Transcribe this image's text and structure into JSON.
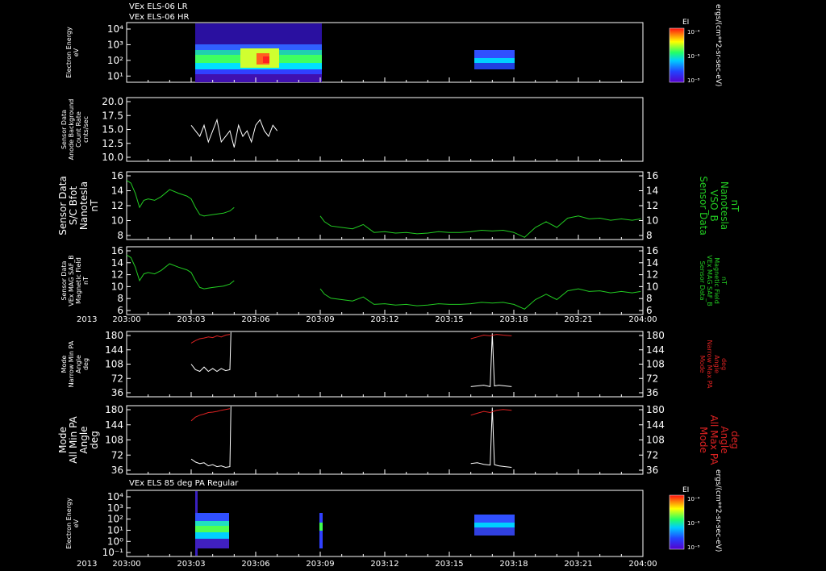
{
  "header": {
    "title_line1": "VEx ELS-06 LR",
    "title_line2": "VEx ELS-06 HR",
    "bottom_title": "VEx ELS 85 deg PA Regular"
  },
  "year_label": "2013",
  "time_ticks": [
    "203:00",
    "203:03",
    "203:06",
    "203:09",
    "203:12",
    "203:15",
    "203:18",
    "203:21",
    "204:00"
  ],
  "colorbar": {
    "title": "EI",
    "labels": [
      "10⁻⁴",
      "10⁻⁶",
      "10⁻⁸"
    ],
    "unit": "ergs/(cm**2-sr-sec-eV)"
  },
  "colors": {
    "background": "#000000",
    "axis": "#ffffff",
    "white_series": "#ffffff",
    "green_series": "#22cc22",
    "red_series": "#dd2222"
  },
  "panels": [
    {
      "id": "p1",
      "ylabel": [
        "Electron Energy",
        "eV"
      ],
      "ticks": [
        "10⁴",
        "10³",
        "10²",
        "10¹"
      ]
    },
    {
      "id": "p2",
      "ylabel": [
        "Sensor Data",
        "Anode Background",
        "Count Rate",
        "cnts/sec"
      ],
      "ticks": [
        "20.0",
        "17.5",
        "15.0",
        "12.5",
        "10.0"
      ]
    },
    {
      "id": "p3",
      "ylabel": [
        "Sensor Data",
        "S/C Bfot",
        "Nanotesla",
        "nT"
      ],
      "ticks": [
        "16",
        "14",
        "12",
        "10",
        "8"
      ],
      "rlabel": [
        "Sensor Data",
        "VSO_B",
        "Nanotesla",
        "nT"
      ],
      "rticks": [
        "16",
        "14",
        "12",
        "10",
        "8"
      ]
    },
    {
      "id": "p4",
      "ylabel": [
        "Sensor Data",
        "VEx MAG SAF_B",
        "Magnetic Field",
        "nT"
      ],
      "ticks": [
        "16",
        "14",
        "12",
        "10",
        "8",
        "6"
      ],
      "rlabel": [
        "Sensor Data",
        "VEx MAG SAF_B",
        "Magnetic Field",
        "nT"
      ],
      "rticks": [
        "16",
        "14",
        "12",
        "10",
        "8",
        "6"
      ]
    },
    {
      "id": "p5",
      "ylabel": [
        "Mode",
        "Narrow Min PA",
        "Angle",
        "deg"
      ],
      "ticks": [
        "180",
        "144",
        "108",
        "72",
        "36"
      ],
      "rlabel": [
        "Mode",
        "Narrow Max PA",
        "Angle",
        "deg"
      ],
      "rticks": [
        "180",
        "144",
        "108",
        "72",
        "36"
      ]
    },
    {
      "id": "p6",
      "ylabel": [
        "Mode",
        "All Min PA",
        "Angle",
        "deg"
      ],
      "ticks": [
        "180",
        "144",
        "108",
        "72",
        "36"
      ],
      "rlabel": [
        "Mode",
        "All Max PA",
        "Angle",
        "deg"
      ],
      "rticks": [
        "180",
        "144",
        "108",
        "72",
        "36"
      ]
    },
    {
      "id": "p7",
      "ylabel": [
        "Electron Energy",
        "eV"
      ],
      "ticks": [
        "10⁴",
        "10³",
        "10²",
        "10¹",
        "10⁰",
        "10⁻¹"
      ]
    }
  ],
  "chart_data": [
    {
      "type": "heatmap",
      "panel": "p1",
      "quantity": "Electron Energy",
      "ylim": [
        1,
        10000
      ],
      "y_scale": "log",
      "active_intervals": [
        [
          "203:03",
          "203:07"
        ],
        [
          "203:15",
          "203:18"
        ]
      ]
    },
    {
      "type": "line",
      "panel": "p2",
      "ylim": [
        8.5,
        20
      ],
      "series": [
        {
          "x": [
            3.0,
            3.2,
            3.4,
            3.6,
            3.8,
            4.0,
            4.2,
            4.4,
            4.6,
            4.8,
            5.0,
            5.2,
            5.4,
            5.6,
            5.8,
            6.0,
            6.2,
            6.4,
            6.6,
            6.8,
            7.0
          ],
          "values": [
            15,
            14,
            13,
            15,
            12,
            14,
            16,
            12,
            13,
            14,
            11,
            15,
            13,
            14,
            12,
            15,
            16,
            14,
            13,
            15,
            14
          ]
        }
      ]
    },
    {
      "type": "line",
      "panel": "p3",
      "ylim": [
        6.5,
        16
      ],
      "series": [
        {
          "x": [
            0.0,
            0.2,
            0.4,
            0.6,
            0.8,
            1.0,
            1.3,
            1.6,
            2.0,
            2.4,
            2.8,
            3.0,
            3.2,
            3.4,
            3.6,
            4.0,
            4.5,
            4.8,
            5.0
          ],
          "values": [
            14.8,
            14.4,
            13.0,
            11.0,
            12.0,
            12.2,
            12.0,
            12.5,
            13.5,
            13.0,
            12.6,
            12.2,
            11.0,
            10.0,
            9.8,
            10.0,
            10.2,
            10.5,
            11.0
          ]
        },
        {
          "x": [
            9.0,
            9.2,
            9.5,
            10.0,
            10.5,
            11.0,
            11.5,
            12.0,
            12.5,
            13.0,
            13.5,
            14.0,
            14.5,
            15.0,
            15.5,
            16.0,
            16.5,
            17.0,
            17.5,
            18.0,
            18.5,
            19.0,
            19.5,
            20.0,
            20.5,
            21.0,
            21.5,
            22.0,
            22.5,
            23.0,
            23.5,
            23.9
          ],
          "values": [
            9.8,
            9.0,
            8.4,
            8.2,
            8.0,
            8.6,
            7.5,
            7.6,
            7.4,
            7.5,
            7.3,
            7.4,
            7.6,
            7.5,
            7.5,
            7.6,
            7.8,
            7.7,
            7.8,
            7.5,
            6.8,
            8.2,
            9.0,
            8.2,
            9.5,
            9.8,
            9.4,
            9.5,
            9.2,
            9.4,
            9.2,
            9.4
          ]
        }
      ]
    },
    {
      "type": "line",
      "panel": "p4",
      "ylim": [
        6,
        16
      ],
      "series": [
        {
          "x": [
            0.0,
            0.2,
            0.4,
            0.6,
            0.8,
            1.0,
            1.3,
            1.6,
            2.0,
            2.4,
            2.8,
            3.0,
            3.2,
            3.4,
            3.6,
            4.0,
            4.5,
            4.8,
            5.0
          ],
          "values": [
            14.8,
            14.4,
            13.0,
            11.0,
            12.0,
            12.2,
            12.0,
            12.5,
            13.5,
            13.0,
            12.6,
            12.2,
            11.0,
            10.0,
            9.8,
            10.0,
            10.2,
            10.5,
            11.0
          ]
        },
        {
          "x": [
            9.0,
            9.2,
            9.5,
            10.0,
            10.5,
            11.0,
            11.5,
            12.0,
            12.5,
            13.0,
            13.5,
            14.0,
            14.5,
            15.0,
            15.5,
            16.0,
            16.5,
            17.0,
            17.5,
            18.0,
            18.5,
            19.0,
            19.5,
            20.0,
            20.5,
            21.0,
            21.5,
            22.0,
            22.5,
            23.0,
            23.5,
            23.9
          ],
          "values": [
            9.8,
            9.0,
            8.4,
            8.2,
            8.0,
            8.6,
            7.5,
            7.6,
            7.4,
            7.5,
            7.3,
            7.4,
            7.6,
            7.5,
            7.5,
            7.6,
            7.8,
            7.7,
            7.8,
            7.5,
            6.8,
            8.2,
            9.0,
            8.2,
            9.5,
            9.8,
            9.4,
            9.5,
            9.2,
            9.4,
            9.2,
            9.4
          ]
        }
      ]
    },
    {
      "type": "line",
      "panel": "p5",
      "ylim": [
        0,
        180
      ],
      "series": [
        {
          "name": "Narrow Min PA",
          "x": [
            3.0,
            3.2,
            3.4,
            3.6,
            3.8,
            4.0,
            4.2,
            4.4,
            4.6,
            4.8,
            4.85
          ],
          "values": [
            90,
            75,
            70,
            82,
            70,
            78,
            70,
            78,
            72,
            75,
            178
          ]
        },
        {
          "name": "Narrow Max PA",
          "x": [
            3.0,
            3.2,
            3.4,
            3.6,
            3.8,
            4.0,
            4.2,
            4.4,
            4.6,
            4.8
          ],
          "values": [
            148,
            155,
            160,
            162,
            165,
            163,
            168,
            165,
            170,
            172
          ]
        },
        {
          "name": "Narrow Min PA",
          "x": [
            16.0,
            16.3,
            16.6,
            16.9,
            17.0,
            17.1,
            17.3,
            17.6,
            17.9
          ],
          "values": [
            28,
            30,
            32,
            28,
            175,
            30,
            32,
            30,
            28
          ]
        },
        {
          "name": "Narrow Max PA",
          "x": [
            16.0,
            16.3,
            16.6,
            16.9,
            17.2,
            17.5,
            17.9
          ],
          "values": [
            160,
            165,
            170,
            168,
            172,
            170,
            168
          ]
        }
      ]
    },
    {
      "type": "line",
      "panel": "p6",
      "ylim": [
        0,
        180
      ],
      "series": [
        {
          "name": "All Min PA",
          "x": [
            3.0,
            3.2,
            3.4,
            3.6,
            3.8,
            4.0,
            4.2,
            4.4,
            4.6,
            4.8,
            4.85
          ],
          "values": [
            40,
            32,
            28,
            30,
            22,
            25,
            20,
            22,
            18,
            20,
            178
          ]
        },
        {
          "name": "All Max PA",
          "x": [
            3.0,
            3.2,
            3.4,
            3.6,
            3.8,
            4.0,
            4.2,
            4.4,
            4.6,
            4.8
          ],
          "values": [
            140,
            150,
            155,
            158,
            162,
            163,
            165,
            168,
            170,
            172
          ]
        },
        {
          "name": "All Min PA",
          "x": [
            16.0,
            16.3,
            16.6,
            16.9,
            17.0,
            17.1,
            17.3,
            17.6,
            17.9
          ],
          "values": [
            28,
            30,
            26,
            24,
            175,
            25,
            22,
            20,
            18
          ]
        },
        {
          "name": "All Max PA",
          "x": [
            16.0,
            16.3,
            16.6,
            16.9,
            17.2,
            17.5,
            17.9
          ],
          "values": [
            155,
            160,
            165,
            162,
            168,
            170,
            168
          ]
        }
      ]
    },
    {
      "type": "heatmap",
      "panel": "p7",
      "quantity": "Electron Energy",
      "ylim": [
        0.1,
        10000
      ],
      "y_scale": "log",
      "active_intervals": [
        [
          "203:03",
          "203:05"
        ],
        [
          "203:09",
          "203:09"
        ],
        [
          "203:15",
          "203:18"
        ]
      ]
    }
  ]
}
